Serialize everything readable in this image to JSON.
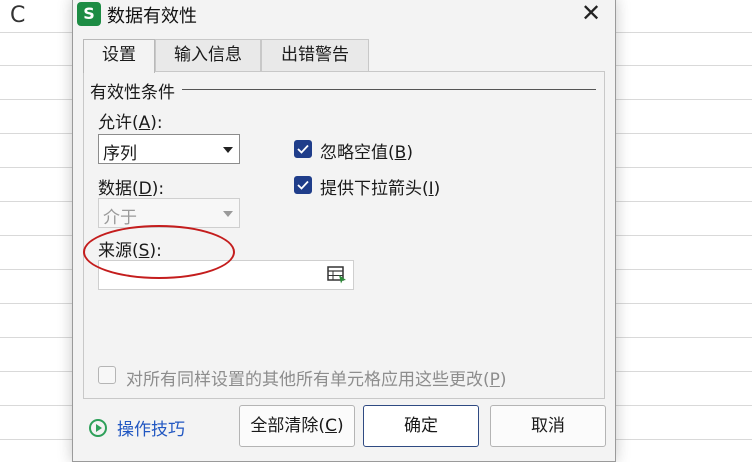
{
  "sheet": {
    "column_letter": "C"
  },
  "dialog": {
    "app_logo": "S",
    "title": "数据有效性",
    "close_glyph": "✕",
    "tabs": [
      {
        "label": "设置",
        "active": true
      },
      {
        "label": "输入信息",
        "active": false
      },
      {
        "label": "出错警告",
        "active": false
      }
    ],
    "conditions": {
      "group_title": "有效性条件",
      "allow": {
        "label": "允许(",
        "hotkey": "A",
        "suffix": "):",
        "value": "序列"
      },
      "data": {
        "label": "数据(",
        "hotkey": "D",
        "suffix": "):",
        "value": "介于",
        "disabled": true
      },
      "ignore_blank": {
        "label": "忽略空值(",
        "hotkey": "B",
        "suffix": ")",
        "checked": true
      },
      "dropdown_arrow": {
        "label": "提供下拉箭头(",
        "hotkey": "I",
        "suffix": ")",
        "checked": true
      },
      "source": {
        "label": "来源(",
        "hotkey": "S",
        "suffix": "):",
        "value": ""
      }
    },
    "apply_all": {
      "label": "对所有同样设置的其他所有单元格应用这些更改(",
      "hotkey": "P",
      "suffix": ")",
      "checked": false,
      "disabled": true
    },
    "footer": {
      "tips_link": "操作技巧",
      "clear_all": {
        "label": "全部清除(",
        "hotkey": "C",
        "suffix": ")"
      },
      "ok": "确定",
      "cancel": "取消"
    },
    "highlight_color": "#c41d1d",
    "checkbox_color": "#1f3d8a",
    "link_color": "#2157c2"
  }
}
